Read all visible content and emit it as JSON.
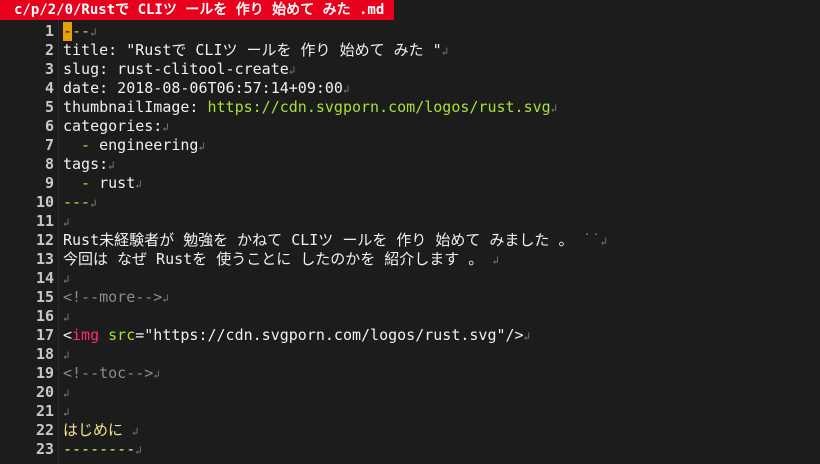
{
  "window": {
    "title": "c/p/2/0/Rustで CLIツ ールを 作り 始めて みた .md"
  },
  "editor": {
    "eol_marker": "↲",
    "lines": [
      {
        "n": "1",
        "segments": [
          {
            "text": "-",
            "cls": "cursor"
          },
          {
            "text": "--",
            "cls": "t-fm"
          }
        ]
      },
      {
        "n": "2",
        "segments": [
          {
            "text": "title: \"Rustで CLIツ ールを 作り 始めて みた \"",
            "cls": "t-default"
          }
        ]
      },
      {
        "n": "3",
        "segments": [
          {
            "text": "slug: rust-clitool-create",
            "cls": "t-default"
          }
        ]
      },
      {
        "n": "4",
        "segments": [
          {
            "text": "date: 2018-08-06T06:57:14+09:00",
            "cls": "t-default"
          }
        ]
      },
      {
        "n": "5",
        "segments": [
          {
            "text": "thumbnailImage: ",
            "cls": "t-default"
          },
          {
            "text": "https://cdn.svgporn.com/logos/rust.svg",
            "cls": "t-url"
          }
        ]
      },
      {
        "n": "6",
        "segments": [
          {
            "text": "categories:",
            "cls": "t-default"
          }
        ]
      },
      {
        "n": "7",
        "segments": [
          {
            "text": "  - ",
            "cls": "t-fm"
          },
          {
            "text": "engineering",
            "cls": "t-default"
          }
        ]
      },
      {
        "n": "8",
        "segments": [
          {
            "text": "tags:",
            "cls": "t-default"
          }
        ]
      },
      {
        "n": "9",
        "segments": [
          {
            "text": "  - ",
            "cls": "t-fm"
          },
          {
            "text": "rust",
            "cls": "t-default"
          }
        ]
      },
      {
        "n": "10",
        "segments": [
          {
            "text": "---",
            "cls": "t-fm"
          }
        ]
      },
      {
        "n": "11",
        "segments": []
      },
      {
        "n": "12",
        "segments": [
          {
            "text": "Rust未経験者が 勉強を かねて CLIツ ールを 作り 始めて みました 。 ",
            "cls": "t-default"
          },
          {
            "text": "˙˙",
            "cls": "red-marks"
          }
        ]
      },
      {
        "n": "13",
        "segments": [
          {
            "text": "今回は なぜ Rustを 使うことに したのかを 紹介します 。 ",
            "cls": "t-default"
          }
        ]
      },
      {
        "n": "14",
        "segments": []
      },
      {
        "n": "15",
        "segments": [
          {
            "text": "<!--more-->",
            "cls": "t-comment"
          }
        ]
      },
      {
        "n": "16",
        "segments": []
      },
      {
        "n": "17",
        "segments": [
          {
            "text": "<",
            "cls": "t-default"
          },
          {
            "text": "img",
            "cls": "t-tag"
          },
          {
            "text": " ",
            "cls": "t-default"
          },
          {
            "text": "src",
            "cls": "t-attr"
          },
          {
            "text": "=\"https://cdn.svgporn.com/logos/rust.svg\"/>",
            "cls": "t-str"
          }
        ]
      },
      {
        "n": "18",
        "segments": []
      },
      {
        "n": "19",
        "segments": [
          {
            "text": "<!--toc-->",
            "cls": "t-comment"
          }
        ]
      },
      {
        "n": "20",
        "segments": []
      },
      {
        "n": "21",
        "segments": []
      },
      {
        "n": "22",
        "segments": [
          {
            "text": "はじめに ",
            "cls": "t-head"
          }
        ]
      },
      {
        "n": "23",
        "segments": [
          {
            "text": "--------",
            "cls": "t-head"
          }
        ]
      }
    ]
  }
}
